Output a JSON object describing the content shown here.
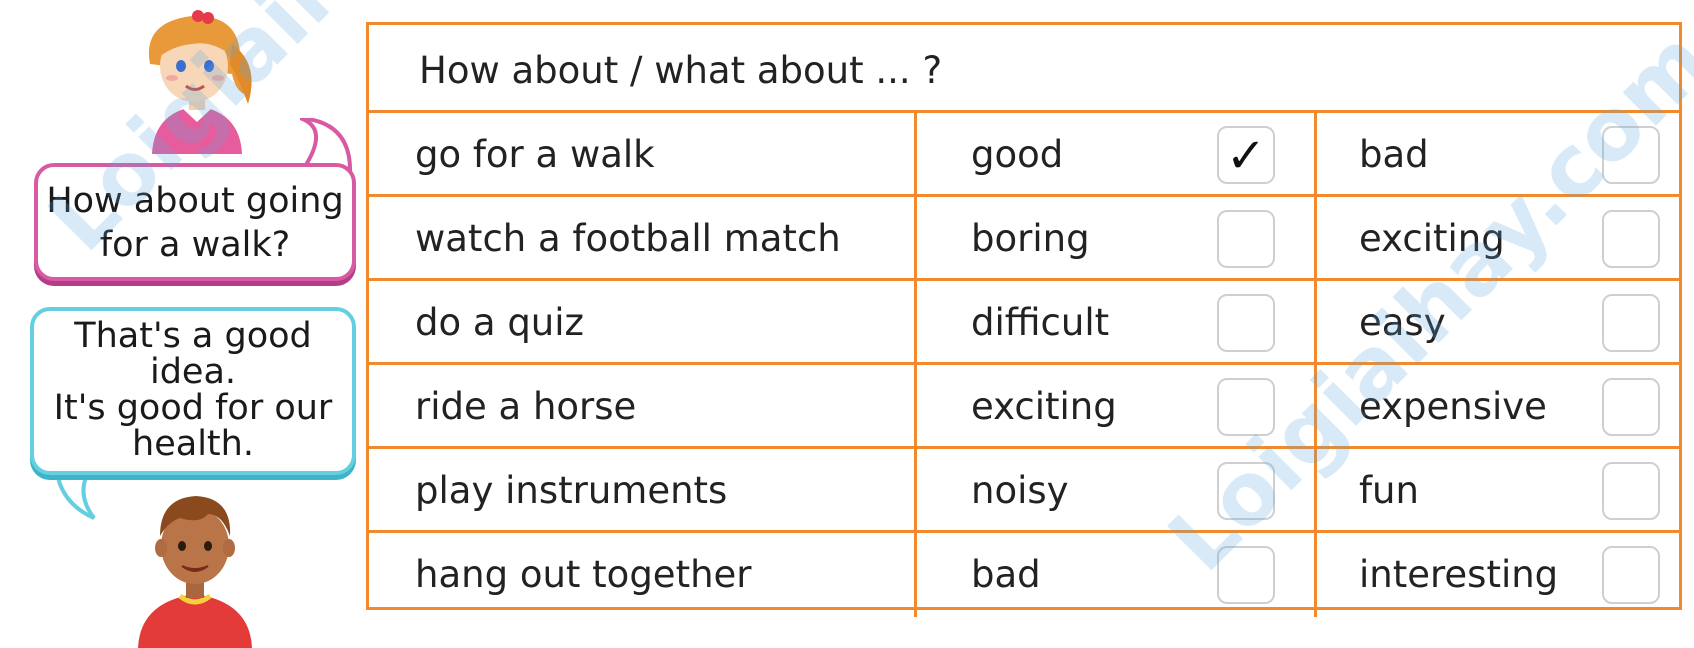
{
  "speech": {
    "girl": "How about going for a walk?",
    "boy_line1": "That's a good idea.",
    "boy_line2": "It's good for our health."
  },
  "table": {
    "header": "How about / what about ... ?",
    "rows": [
      {
        "activity": "go for a walk",
        "opt1": "good",
        "opt1_checked": true,
        "opt2": "bad",
        "opt2_checked": false
      },
      {
        "activity": "watch a football match",
        "opt1": "boring",
        "opt1_checked": false,
        "opt2": "exciting",
        "opt2_checked": false
      },
      {
        "activity": "do a quiz",
        "opt1": "difficult",
        "opt1_checked": false,
        "opt2": "easy",
        "opt2_checked": false
      },
      {
        "activity": "ride a horse",
        "opt1": "exciting",
        "opt1_checked": false,
        "opt2": "expensive",
        "opt2_checked": false
      },
      {
        "activity": "play instruments",
        "opt1": "noisy",
        "opt1_checked": false,
        "opt2": "fun",
        "opt2_checked": false
      },
      {
        "activity": "hang out together",
        "opt1": "bad",
        "opt1_checked": false,
        "opt2": "interesting",
        "opt2_checked": false
      }
    ],
    "check_glyph": "✓"
  },
  "watermark": "Loigiaihay.com",
  "colors": {
    "border": "#f08a2c",
    "bubble_pink": "#d85aa2",
    "bubble_cyan": "#63cfe0",
    "watermark": "#5aa9e0"
  }
}
